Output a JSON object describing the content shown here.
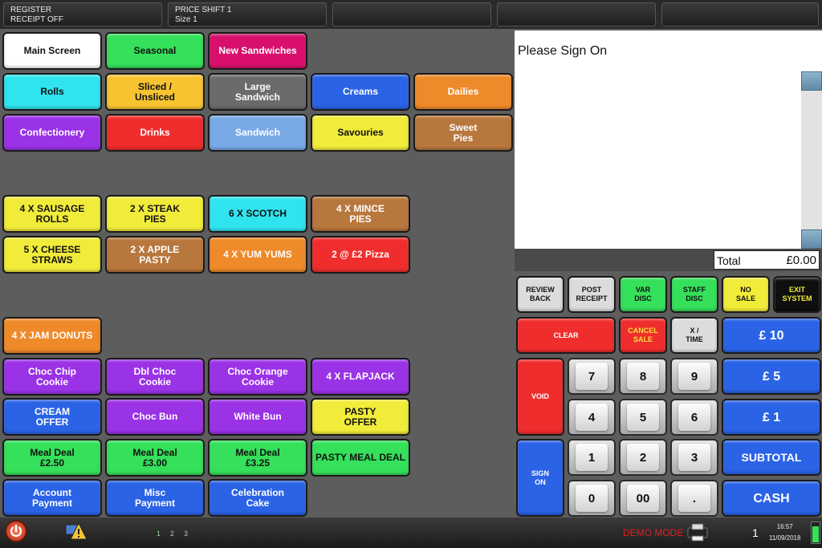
{
  "topbar": {
    "register_line1": "REGISTER",
    "register_line2": "RECEIPT OFF",
    "price_line1": "PRICE SHIFT 1",
    "price_line2": "Size 1"
  },
  "categories": {
    "main_screen": "Main Screen",
    "seasonal": "Seasonal",
    "new_sandwiches": "New Sandwiches",
    "rolls": "Rolls",
    "sliced_unsliced": "Sliced /\nUnsliced",
    "large_sandwich": "Large\nSandwich",
    "creams": "Creams",
    "dailies": "Dailies",
    "confectionery": "Confectionery",
    "drinks": "Drinks",
    "sandwich": "Sandwich",
    "savouries": "Savouries",
    "sweet_pies": "Sweet\nPies"
  },
  "products": {
    "sausage_rolls": "4 X SAUSAGE\nROLLS",
    "steak_pies": "2 X STEAK\nPIES",
    "scotch": "6 X SCOTCH",
    "mince_pies": "4 X MINCE\nPIES",
    "cheese_straws": "5 X CHEESE\nSTRAWS",
    "apple_pasty": "2 X APPLE\nPASTY",
    "yum_yums": "4 X YUM YUMS",
    "pizza": "2 @ £2 Pizza",
    "jam_donuts": "4 X JAM DONUTS",
    "choc_chip": "Choc Chip\nCookie",
    "dbl_choc": "Dbl Choc\nCookie",
    "choc_orange": "Choc Orange Cookie",
    "flapjack": "4 X FLAPJACK",
    "cream_offer": "CREAM\nOFFER",
    "choc_bun": "Choc Bun",
    "white_bun": "White Bun",
    "pasty_offer": "PASTY\nOFFER",
    "meal_250": "Meal Deal\n£2.50",
    "meal_300": "Meal Deal\n£3.00",
    "meal_325": "Meal Deal\n£3.25",
    "pasty_meal": "PASTY MEAL DEAL",
    "account_payment": "Account\nPayment",
    "misc_payment": "Misc\nPayment",
    "celebration_cake": "Celebration\nCake"
  },
  "receipt": {
    "prompt": "Please Sign On",
    "total_label": "Total",
    "total_value": "£0.00"
  },
  "functions": {
    "review_back": "REVIEW\nBACK",
    "post_receipt": "POST\nRECEIPT",
    "var_disc": "VAR\nDISC",
    "staff_disc": "STAFF\nDISC",
    "no_sale": "NO\nSALE",
    "exit_system": "EXIT\nSYSTEM",
    "clear": "CLEAR",
    "cancel_sale": "CANCEL\nSALE",
    "x_time": "X /\nTIME",
    "void": "VOID",
    "sign_on": "SIGN\nON",
    "ten": "£ 10",
    "five": "£ 5",
    "one": "£ 1",
    "subtotal": "SUBTOTAL",
    "cash": "CASH"
  },
  "keypad": [
    "7",
    "8",
    "9",
    "4",
    "5",
    "6",
    "1",
    "2",
    "3",
    "0",
    "00",
    "."
  ],
  "bottombar": {
    "pages": [
      "1",
      "2",
      "3"
    ],
    "mode": "DEMO MODE",
    "count": "1",
    "time": "16:57",
    "date": "11/09/2018"
  },
  "colors": {
    "white": "#ffffff",
    "green": "#35e05a",
    "magenta": "#d8106c",
    "cyan": "#30e4ef",
    "yellow": "#f1e43a",
    "grey": "#6b6b6b",
    "blue": "#2b63e6",
    "orange": "#ef8a2a",
    "purple": "#9a32e6",
    "red": "#ef2d2d",
    "lightblue": "#79a9e6",
    "brown": "#b8773d",
    "black": "#111111"
  }
}
